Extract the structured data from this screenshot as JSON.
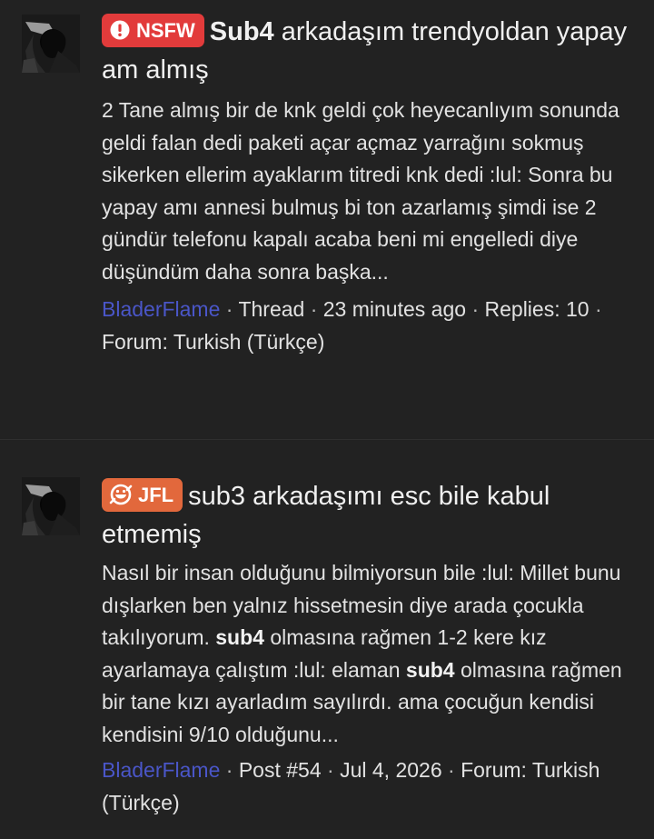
{
  "results": [
    {
      "badge": "NSFW",
      "badge_icon": "exclamation-circle-icon",
      "badge_color": "#e23b3b",
      "title_bold": "Sub4",
      "title_rest": " arkadaşım trendyoldan yapay am almış",
      "snippet": "2 Tane almış bir de knk geldi çok heyecanlıyım sonunda geldi falan dedi paketi açar açmaz yarrağını sokmuş sikerken ellerim ayaklarım titredi knk dedi :lul: Sonra bu yapay amı annesi bulmuş bi ton azarlamış şimdi ise 2 gündür telefonu kapalı acaba beni mi engelledi diye düşündüm daha sonra başka...",
      "author": "BladerFlame",
      "type": "Thread",
      "time": "23 minutes ago",
      "replies_label": "Replies:",
      "replies": "10",
      "forum_label": "Forum:",
      "forum": "Turkish (Türkçe)"
    },
    {
      "badge": "JFL",
      "badge_icon": "grinning-face-icon",
      "badge_color": "#e2683c",
      "title": "sub3 arkadaşımı esc bile kabul etmemiş",
      "snippet_parts": [
        "Nasıl bir insan olduğunu bilmiyorsun bile :lul: Millet bunu dışlarken ben yalnız hissetmesin diye arada çocukla takılıyorum. ",
        "sub4",
        " olmasına rağmen 1-2 kere kız ayarlamaya çalıştım :lul: elaman ",
        "sub4",
        " olmasına rağmen bir tane kızı ayarladım sayılırdı. ama çocuğun kendisi kendisini 9/10 olduğunu..."
      ],
      "author": "BladerFlame",
      "post": "Post #54",
      "date": "Jul 4, 2026",
      "forum_label": "Forum:",
      "forum": "Turkish (Türkçe)"
    }
  ],
  "separator": "·"
}
